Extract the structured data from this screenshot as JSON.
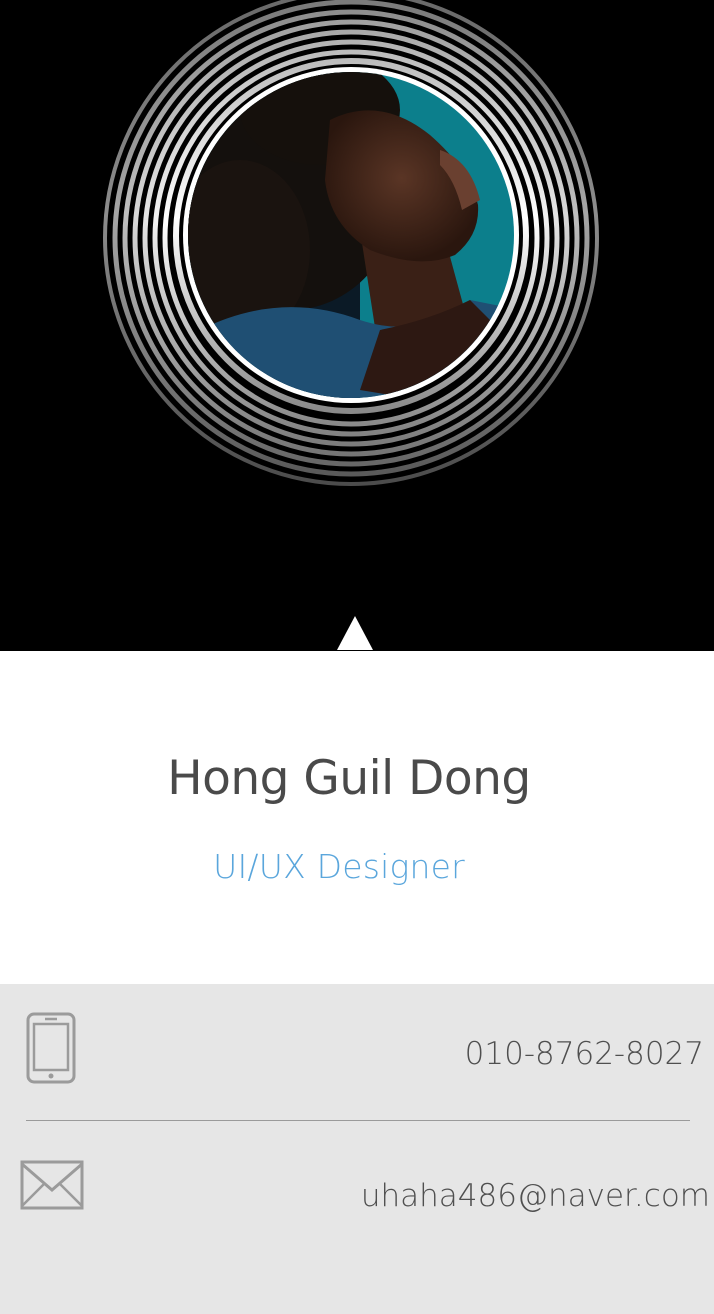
{
  "profile": {
    "name": "Hong Guil Dong",
    "role": "UI/UX Designer"
  },
  "contact": {
    "phone": {
      "icon": "smartphone-icon",
      "value": "010-8762-8027"
    },
    "email": {
      "icon": "envelope-icon",
      "value": "uhaha486@naver.com"
    }
  },
  "colors": {
    "hero_background": "#000000",
    "name_text": "#4a4a4a",
    "role_text": "#5aa6dc",
    "contact_background": "#e6e6e6",
    "photo_backdrop": "#0c7f8c"
  }
}
